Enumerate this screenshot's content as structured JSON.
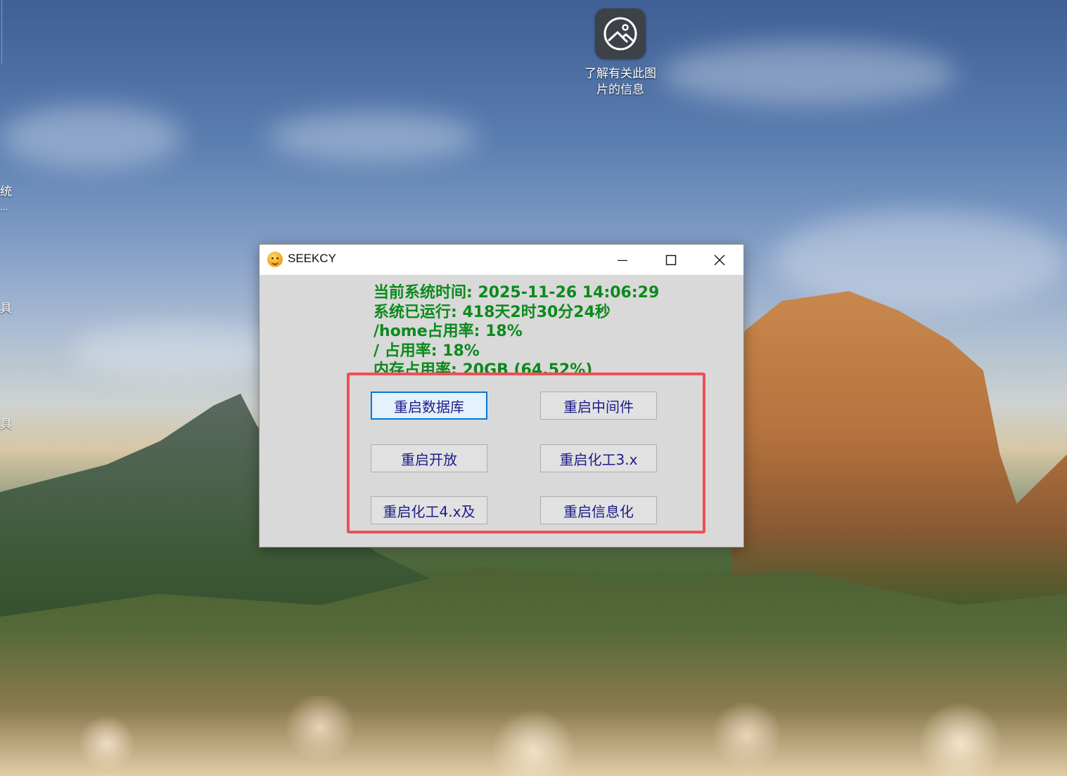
{
  "desktop": {
    "edge_labels": [
      "统",
      "...",
      "具",
      "具"
    ],
    "icon": {
      "name": "picture-info-icon",
      "label_line1": "了解有关此图",
      "label_line2": "片的信息"
    }
  },
  "window": {
    "title": "SEEKCY",
    "controls": {
      "minimize": "—",
      "maximize": "☐",
      "close": "✕"
    },
    "info": {
      "line1": "当前系统时间: 2025-11-26 14:06:29",
      "line2": "系统已运行: 418天2时30分24秒",
      "line3": "/home占用率: 18%",
      "line4": "/ 占用率: 18%",
      "line5": "内存占用率: 20GB (64.52%)"
    },
    "buttons": {
      "restart_db": "重启数据库",
      "restart_middleware": "重启中间件",
      "restart_open": "重启开放",
      "restart_chem3": "重启化工3.x",
      "restart_chem4": "重启化工4.x及",
      "restart_info": "重启信息化"
    }
  },
  "colors": {
    "info_text": "#0b8a1c",
    "button_text": "#1d1d8a",
    "highlight": "#ef4f57",
    "focus": "#0078d7"
  }
}
